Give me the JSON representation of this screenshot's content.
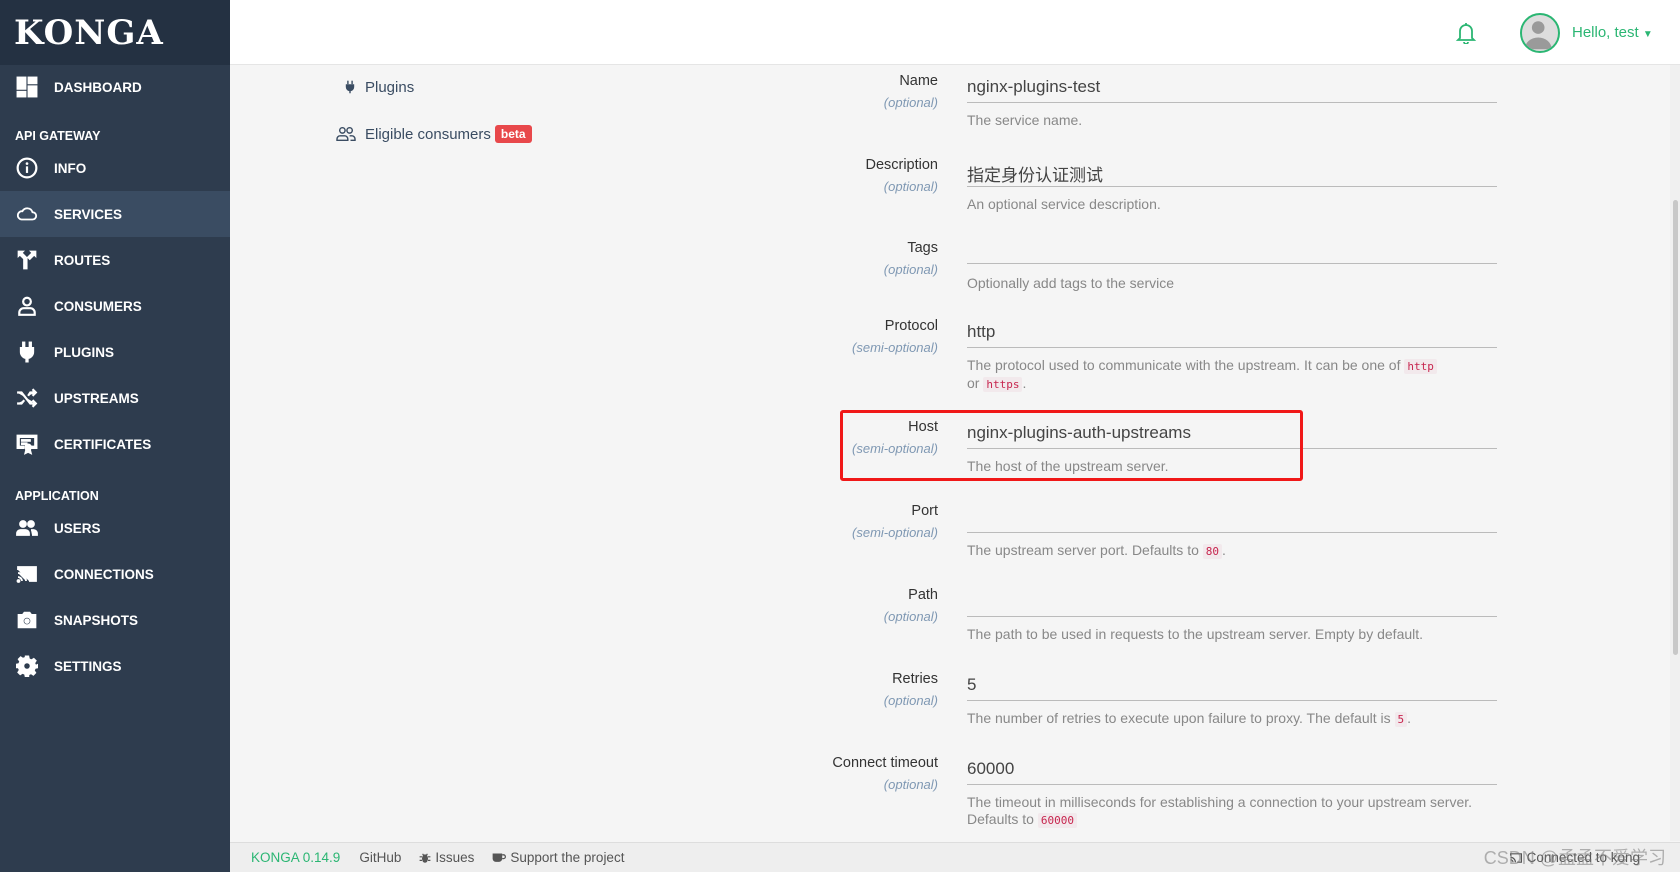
{
  "brand": "KONGA",
  "sidebar": {
    "dashboard": "DASHBOARD",
    "section_api": "API GATEWAY",
    "items_api": [
      "INFO",
      "SERVICES",
      "ROUTES",
      "CONSUMERS",
      "PLUGINS",
      "UPSTREAMS",
      "CERTIFICATES"
    ],
    "section_app": "APPLICATION",
    "items_app": [
      "USERS",
      "CONNECTIONS",
      "SNAPSHOTS",
      "SETTINGS"
    ]
  },
  "header": {
    "greeting": "Hello, test"
  },
  "subnav": {
    "plugins": "Plugins",
    "eligible": "Eligible consumers",
    "badge": "beta"
  },
  "form": {
    "name": {
      "label": "Name",
      "opt": "(optional)",
      "value": "nginx-plugins-test",
      "help": "The service name."
    },
    "description": {
      "label": "Description",
      "opt": "(optional)",
      "value": "指定身份认证测试",
      "help": "An optional service description."
    },
    "tags": {
      "label": "Tags",
      "opt": "(optional)",
      "value": "",
      "help": "Optionally add tags to the service"
    },
    "protocol": {
      "label": "Protocol",
      "opt": "(semi-optional)",
      "value": "http",
      "help_a": "The protocol used to communicate with the upstream. It can be one of",
      "code1": "http",
      "help_b": "or",
      "code2": "https",
      "help_c": "."
    },
    "host": {
      "label": "Host",
      "opt": "(semi-optional)",
      "value": "nginx-plugins-auth-upstreams",
      "help": "The host of the upstream server."
    },
    "port": {
      "label": "Port",
      "opt": "(semi-optional)",
      "value": "",
      "help_a": "The upstream server port. Defaults to",
      "code": "80",
      "help_b": "."
    },
    "path": {
      "label": "Path",
      "opt": "(optional)",
      "value": "",
      "help": "The path to be used in requests to the upstream server. Empty by default."
    },
    "retries": {
      "label": "Retries",
      "opt": "(optional)",
      "value": "5",
      "help_a": "The number of retries to execute upon failure to proxy. The default is",
      "code": "5",
      "help_b": "."
    },
    "timeout": {
      "label": "Connect timeout",
      "opt": "(optional)",
      "value": "60000",
      "help_a": "The timeout in milliseconds for establishing a connection to your upstream server. Defaults to",
      "code": "60000"
    }
  },
  "footer": {
    "version": "KONGA 0.14.9",
    "github": "GitHub",
    "issues": "Issues",
    "support": "Support the project",
    "connected": "Connected to kong"
  },
  "watermark": "CSDN @孟孟不爱学习",
  "colors": {
    "sidebar": "#2e3c4e",
    "accent": "#2bb673",
    "highlight": "#f01818"
  }
}
